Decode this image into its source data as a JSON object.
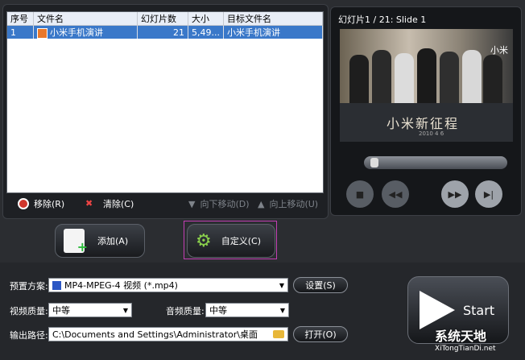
{
  "list": {
    "columns": [
      "序号",
      "文件名",
      "幻灯片数",
      "大小",
      "目标文件名"
    ],
    "rows": [
      {
        "index": "1",
        "file": "小米手机演讲",
        "slides": "21",
        "size": "5,49...",
        "target": "小米手机演讲"
      }
    ]
  },
  "toolbar": {
    "remove": "移除(R)",
    "clear": "清除(C)",
    "move_down": "向下移动(D)",
    "move_up": "向上移动(U)"
  },
  "preview": {
    "title": "幻灯片1 / 21: Slide 1",
    "slide_text": "小米新征程",
    "slide_date": "2010 4 6",
    "brand": "小米"
  },
  "actions": {
    "add": "添加(A)",
    "custom": "自定义(C)"
  },
  "settings": {
    "preset_label": "预置方案:",
    "preset_value": "MP4-MPEG-4 视频 (*.mp4)",
    "settings_button": "设置(S)",
    "video_quality_label": "视频质量:",
    "video_quality_value": "中等",
    "audio_quality_label": "音频质量:",
    "audio_quality_value": "中等",
    "output_label": "输出路径:",
    "output_value": "C:\\Documents and Settings\\Administrator\\桌面",
    "open_button": "打开(O)",
    "start_button": "Start"
  },
  "watermark": {
    "main": "系统天地",
    "url": "XiTongTianDi.net"
  }
}
